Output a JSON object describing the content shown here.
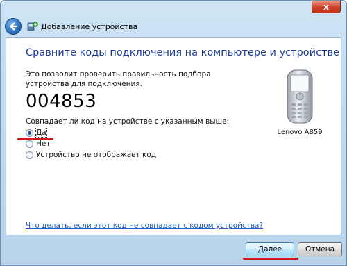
{
  "window": {
    "title": "Добавление устройства",
    "close_glyph": "x"
  },
  "main": {
    "heading": "Сравните коды подключения на компьютере и устройстве",
    "description": "Это позволит проверить правильность подбора устройства для подключения.",
    "pairing_code": "004853",
    "question": "Совпадает ли код на устройстве с указанным выше:",
    "options": [
      {
        "label": "Да",
        "selected": true
      },
      {
        "label": "Нет",
        "selected": false
      },
      {
        "label": "Устройство не отображает код",
        "selected": false
      }
    ],
    "help_link": "Что делать, если этот код не совпадает с кодом устройства?"
  },
  "device": {
    "name": "Lenovo A859",
    "icon": "mobile-phone-icon"
  },
  "buttons": {
    "next_label": "Далее",
    "cancel_label": "Отмена"
  },
  "colors": {
    "heading": "#1c3a92",
    "link": "#1f5fc0",
    "annotation_red": "#d4171b"
  }
}
